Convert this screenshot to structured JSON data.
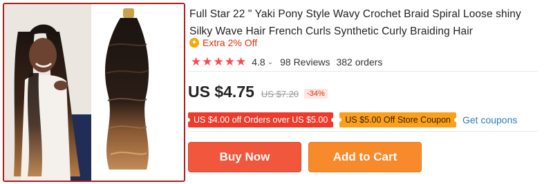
{
  "product": {
    "title": "Full Star 22 \" Yaki Pony Style Wavy Crochet Braid Spiral Loose shiny Silky Wave Hair French Curls Synthetic Curly Braiding Hair",
    "extra_off": "Extra 2% Off",
    "image_alt": "Product image"
  },
  "rating": {
    "stars": 5,
    "value": "4.8",
    "reviews": "98 Reviews",
    "orders": "382 orders"
  },
  "price": {
    "current": "US $4.75",
    "original": "US $7.20",
    "discount": "-34%"
  },
  "coupons": {
    "seller_coupon": "US $4.00 off Orders over US $5.00",
    "store_coupon": "US $5.00 Off Store Coupon",
    "get_label": "Get coupons"
  },
  "actions": {
    "buy_now": "Buy Now",
    "add_to_cart": "Add to Cart"
  },
  "icons": {
    "star": "star-icon",
    "coin": "coin-icon",
    "chevron": "chevron-down-icon"
  },
  "colors": {
    "accent_red": "#e62e04",
    "buy_button": "#f0573d",
    "cart_button": "#f98a2b",
    "link_blue": "#2e7bb8",
    "frame_border": "#b51a1a"
  }
}
